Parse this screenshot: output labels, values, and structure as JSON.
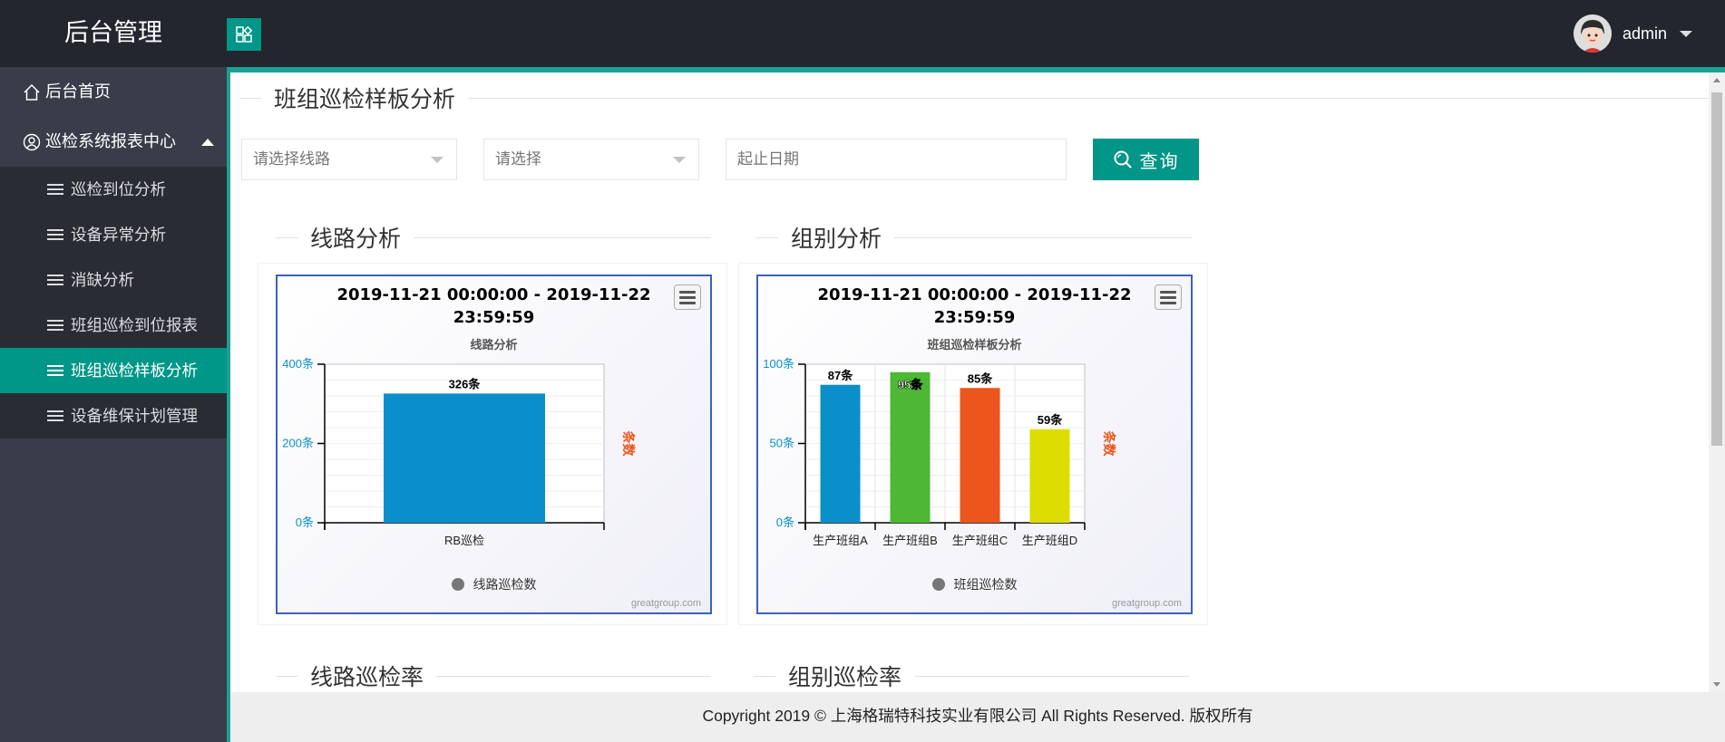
{
  "header": {
    "brand": "后台管理",
    "user": {
      "name": "admin"
    }
  },
  "sidebar": {
    "home": "后台首页",
    "group": "巡检系统报表中心",
    "items": [
      {
        "label": "巡检到位分析"
      },
      {
        "label": "设备异常分析"
      },
      {
        "label": "消缺分析"
      },
      {
        "label": "班组巡检到位报表"
      },
      {
        "label": "班组巡检样板分析",
        "active": true
      },
      {
        "label": "设备维保计划管理"
      }
    ]
  },
  "page": {
    "title": "班组巡检样板分析",
    "filters": {
      "route_placeholder": "请选择线路",
      "group_placeholder": "请选择",
      "date_placeholder": "起止日期",
      "query_label": "查询"
    },
    "sections": {
      "route": "线路分析",
      "group": "组别分析",
      "route_rate": "线路巡检率",
      "group_rate": "组别巡检率"
    }
  },
  "chart_data": [
    {
      "type": "bar",
      "title_line1": "2019-11-21 00:00:00 - 2019-11-22",
      "title_line2": "23:59:59",
      "subtitle": "线路分析",
      "categories": [
        "RB巡检"
      ],
      "series": [
        {
          "name": "线路巡检数",
          "values": [
            326
          ],
          "colors": [
            "#0a8fcb"
          ]
        }
      ],
      "data_labels": [
        "326条"
      ],
      "y_ticks": [
        "0条",
        "200条",
        "400条"
      ],
      "ylim": [
        0,
        400
      ],
      "y_right_label": "条数",
      "credits": "greatgroup.com",
      "legend": "bottom-center"
    },
    {
      "type": "bar",
      "title_line1": "2019-11-21 00:00:00 - 2019-11-22",
      "title_line2": "23:59:59",
      "subtitle": "班组巡检样板分析",
      "categories": [
        "生产班组A",
        "生产班组B",
        "生产班组C",
        "生产班组D"
      ],
      "series": [
        {
          "name": "班组巡检数",
          "values": [
            87,
            95,
            85,
            59
          ],
          "colors": [
            "#0a8fcb",
            "#4db833",
            "#ec551b",
            "#dcdd00"
          ]
        }
      ],
      "data_labels": [
        "87条",
        "95条",
        "85条",
        "59条"
      ],
      "y_ticks": [
        "0条",
        "50条",
        "100条"
      ],
      "ylim": [
        0,
        100
      ],
      "y_right_label": "条数",
      "credits": "greatgroup.com",
      "legend": "bottom-center"
    }
  ],
  "footer": {
    "copyright": "Copyright 2019 © 上海格瑞特科技实业有限公司 All Rights Reserved. 版权所有"
  }
}
